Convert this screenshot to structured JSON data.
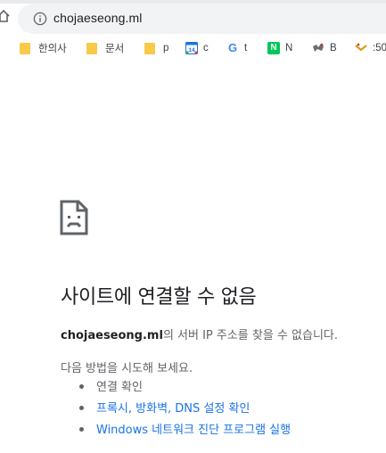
{
  "browser": {
    "url": "chojaeseong.ml",
    "bookmarks": [
      {
        "icon": "folder-icon",
        "label": "한의사"
      },
      {
        "icon": "folder-icon",
        "label": "문서"
      },
      {
        "icon": "folder-icon",
        "label": "p"
      },
      {
        "icon": "calendar-icon",
        "icon_text": "14",
        "label": "c"
      },
      {
        "icon": "google-icon",
        "icon_text": "G",
        "label": "t"
      },
      {
        "icon": "naver-icon",
        "icon_text": "N",
        "label": "N"
      },
      {
        "icon": "site-favicon",
        "label": "B"
      },
      {
        "icon": "bookmark-favicon",
        "label": ":50"
      }
    ]
  },
  "error": {
    "title": "사이트에 연결할 수 없음",
    "host": "chojaeseong.ml",
    "message": "의 서버 IP 주소를 찾을 수 없습니다.",
    "suggestions_heading": "다음 방법을 시도해 보세요.",
    "suggestions": [
      {
        "text": "연결 확인",
        "link": false
      },
      {
        "text": "프록시, 방화벽, DNS 설정 확인",
        "link": true
      },
      {
        "text": "Windows 네트워크 진단 프로그램 실행",
        "link": true
      }
    ]
  },
  "colors": {
    "link": "#1a73e8",
    "title": "#202124",
    "body_text": "#5f6368",
    "omnibox_bg": "#f1f3f4",
    "folder": "#f9c94a"
  }
}
